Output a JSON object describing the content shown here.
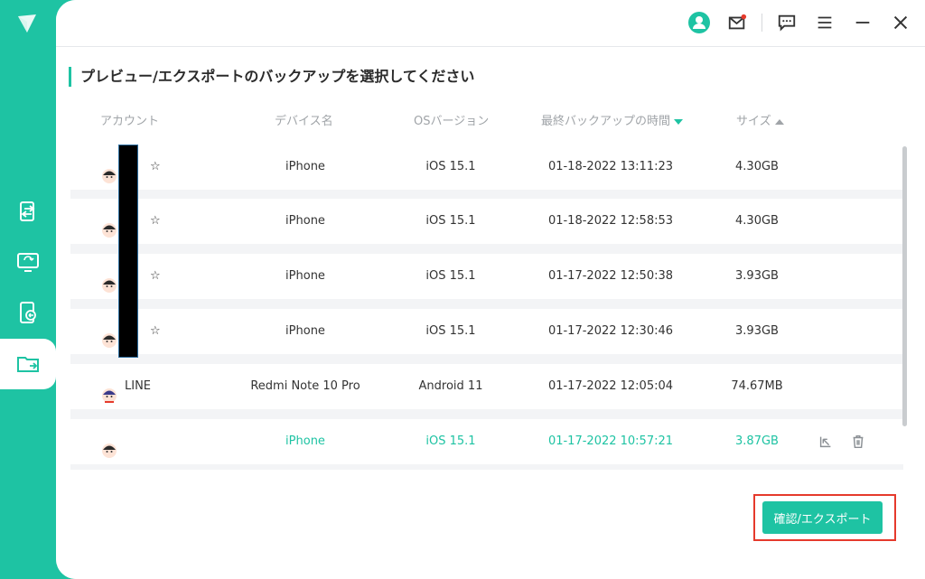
{
  "app": {
    "logo": "app-logo-icon"
  },
  "sidebar": {
    "items": [
      {
        "name": "transfer",
        "icon": "phone-transfer-icon"
      },
      {
        "name": "restore",
        "icon": "desktop-sync-icon"
      },
      {
        "name": "backup",
        "icon": "phone-backup-icon"
      },
      {
        "name": "export",
        "icon": "folder-export-icon",
        "active": true
      }
    ]
  },
  "topbar": {
    "icons": [
      "account-icon",
      "mail-icon",
      "feedback-icon",
      "menu-icon",
      "minimize-icon",
      "close-icon"
    ]
  },
  "page": {
    "title": "プレビュー/エクスポートのバックアップを選択してください"
  },
  "table": {
    "headers": {
      "account": "アカウント",
      "device": "デバイス名",
      "os": "OSバージョン",
      "time": "最終バックアップの時間",
      "size": "サイズ"
    },
    "sort": {
      "time": "desc",
      "size": "asc"
    },
    "rows": [
      {
        "account": "☆",
        "device": "iPhone",
        "os": "iOS 15.1",
        "time": "01-18-2022 13:11:23",
        "size": "4.30GB"
      },
      {
        "account": "☆",
        "device": "iPhone",
        "os": "iOS 15.1",
        "time": "01-18-2022 12:58:53",
        "size": "4.30GB"
      },
      {
        "account": "☆",
        "device": "iPhone",
        "os": "iOS 15.1",
        "time": "01-17-2022 12:50:38",
        "size": "3.93GB"
      },
      {
        "account": "☆",
        "device": "iPhone",
        "os": "iOS 15.1",
        "time": "01-17-2022 12:30:46",
        "size": "3.93GB"
      },
      {
        "account": "LINE",
        "device": "Redmi Note 10 Pro",
        "os": "Android 11",
        "time": "01-17-2022 12:05:04",
        "size": "74.67MB"
      },
      {
        "account": "",
        "device": "iPhone",
        "os": "iOS 15.1",
        "time": "01-17-2022 10:57:21",
        "size": "3.87GB",
        "selected": true
      }
    ]
  },
  "actions": {
    "confirm_label": "確認/エクスポート"
  },
  "colors": {
    "accent": "#1ec3a3",
    "highlight_border": "#e53a2c"
  }
}
